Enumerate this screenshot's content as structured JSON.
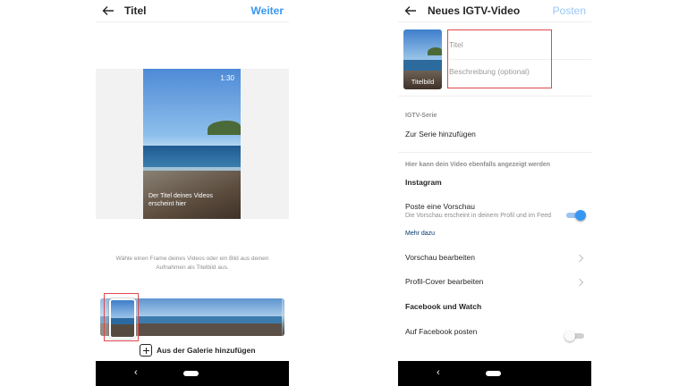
{
  "left": {
    "header": {
      "title": "Titel",
      "action": "Weiter"
    },
    "video": {
      "duration": "1:30",
      "caption": "Der Titel deines Videos erscheint hier"
    },
    "hint": "Wähle einen Frame deines Videos oder ein Bild aus deinen Aufnahmen als Titelbild aus.",
    "gallery_label": "Aus der Galerie hinzufügen",
    "nav": {
      "back": "‹"
    }
  },
  "right": {
    "header": {
      "title": "Neues IGTV-Video",
      "action": "Posten"
    },
    "thumb_label": "Titelbild",
    "title_placeholder": "Titel",
    "description_placeholder": "Beschreibung (optional)",
    "series": {
      "header": "IGTV-Serie",
      "add_label": "Zur Serie hinzufügen"
    },
    "also_shown": "Hier kann dein Video ebenfalls angezeigt werden",
    "instagram": {
      "header": "Instagram",
      "preview_title": "Poste eine Vorschau",
      "preview_sub": "Die Vorschau erscheint in deinem Profil und im Feed",
      "more": "Mehr dazu",
      "preview_toggle": "on",
      "edit_preview": "Vorschau bearbeiten",
      "edit_profile_cover": "Profil-Cover bearbeiten"
    },
    "facebook": {
      "header": "Facebook und Watch",
      "post_label": "Auf Facebook posten",
      "post_toggle": "off"
    },
    "nav": {
      "back": "‹"
    }
  },
  "colors": {
    "accent": "#3897f0",
    "highlight": "#e0484d"
  }
}
